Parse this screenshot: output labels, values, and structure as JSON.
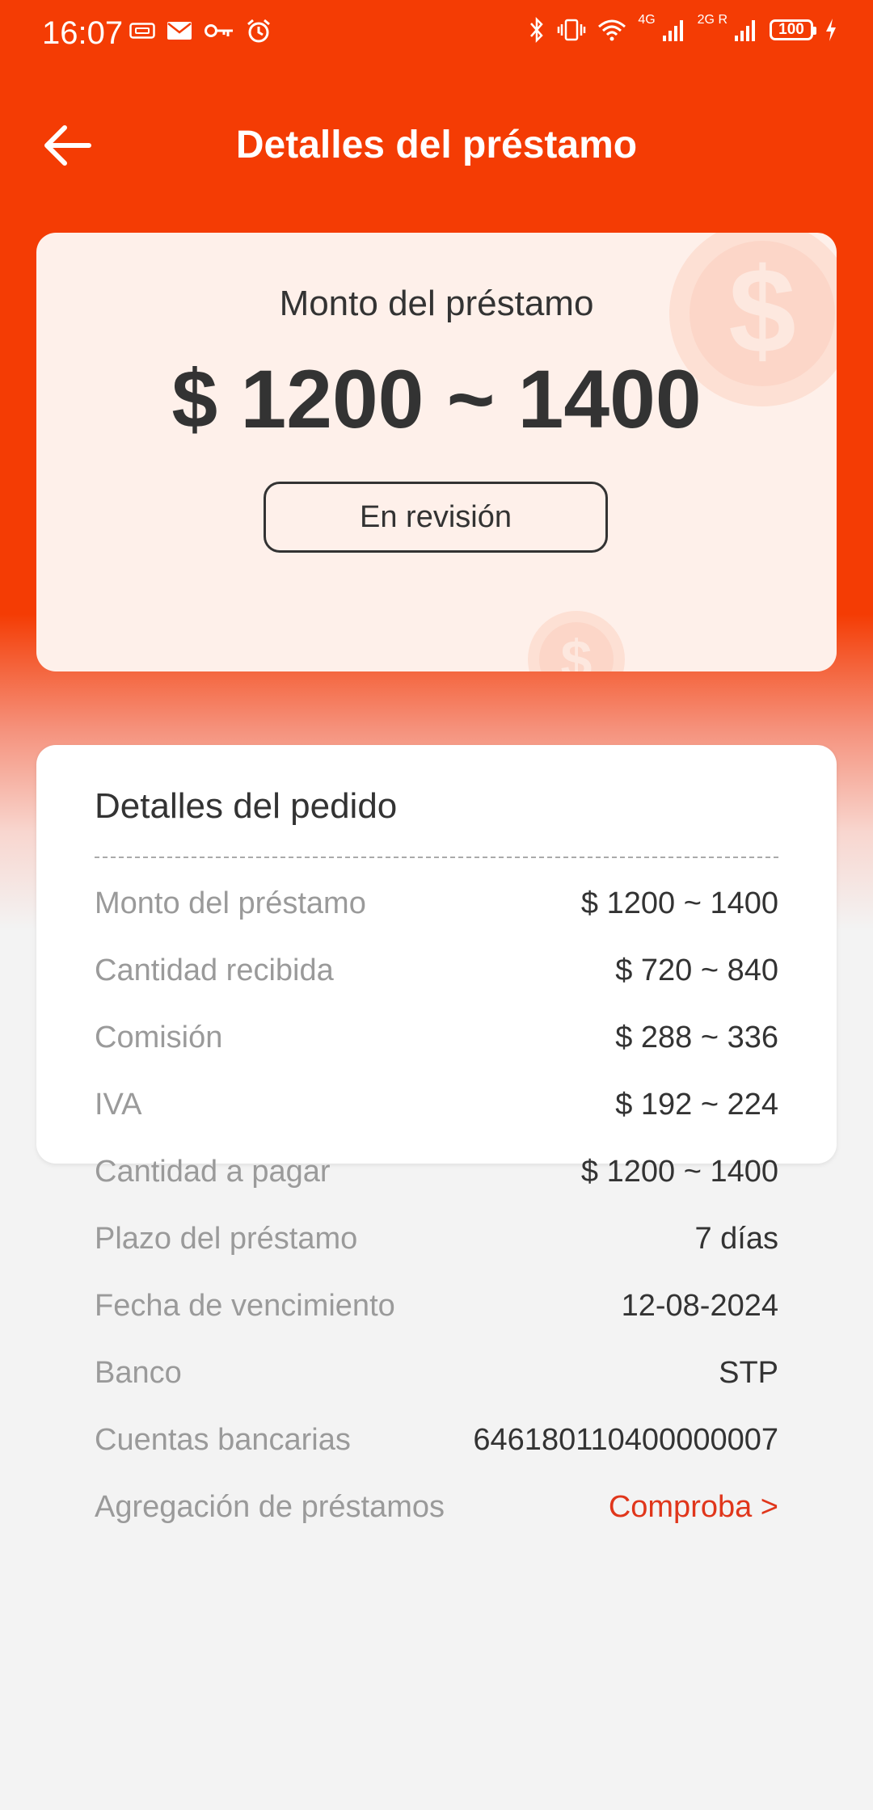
{
  "status_bar": {
    "time": "16:07",
    "signal_1_label": "4G",
    "signal_2_label": "2G R",
    "battery": "100"
  },
  "header": {
    "title": "Detalles del préstamo"
  },
  "loan_card": {
    "label": "Monto del préstamo",
    "amount": "$ 1200 ~ 1400",
    "status": "En revisión"
  },
  "details": {
    "title": "Detalles del pedido",
    "rows": [
      {
        "label": "Monto del préstamo",
        "value": "$ 1200 ~ 1400"
      },
      {
        "label": "Cantidad recibida",
        "value": "$ 720 ~ 840"
      },
      {
        "label": "Comisión",
        "value": "$ 288 ~ 336"
      },
      {
        "label": "IVA",
        "value": "$ 192 ~ 224"
      },
      {
        "label": "Cantidad a pagar",
        "value": "$ 1200 ~ 1400"
      },
      {
        "label": "Plazo del préstamo",
        "value": "7 días"
      },
      {
        "label": "Fecha de vencimiento",
        "value": "12-08-2024"
      },
      {
        "label": "Banco",
        "value": "STP"
      },
      {
        "label": "Cuentas bancarias",
        "value": "646180110400000007"
      },
      {
        "label": "Agregación de préstamos",
        "value": "Comproba >"
      }
    ]
  },
  "colors": {
    "primary": "#f43c04",
    "card_bg": "#fef0ea",
    "link": "#e0361b"
  }
}
